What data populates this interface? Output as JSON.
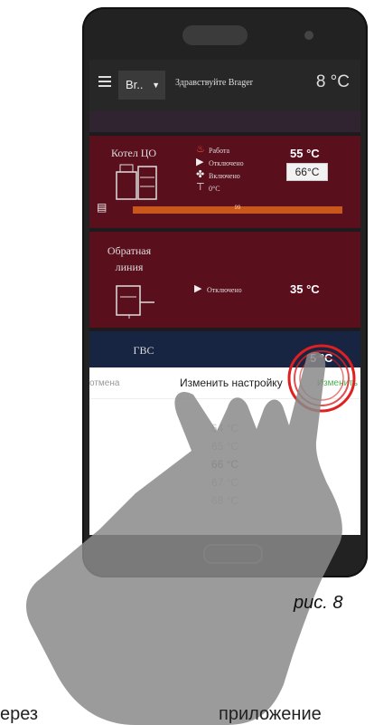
{
  "header": {
    "device": "Br..",
    "greeting": "Здравствуйте Brager",
    "outdoor_temp": "8 °C"
  },
  "boiler": {
    "title": "Котел ЦО",
    "statuses": [
      "Работа",
      "Отключено",
      "Включено",
      "0°C"
    ],
    "temp": "55 °C",
    "setpoint": "66°C",
    "fuel_level": 99,
    "fuel_label": "99"
  },
  "return_line": {
    "title": "Обратная линия",
    "status": "Отключено",
    "temp": "35 °C"
  },
  "dhw": {
    "title": "ГВС",
    "temp_partial": "5 °C"
  },
  "picker": {
    "cancel": "отмена",
    "title": "Изменить настройку",
    "apply": "Изменить",
    "options": [
      "64 °C",
      "65 °C",
      "66 °C",
      "67 °C",
      "68 °C"
    ],
    "selected": "66 °C"
  },
  "caption": "рис. 8",
  "footer_left": "ерез",
  "footer_right": "приложение"
}
